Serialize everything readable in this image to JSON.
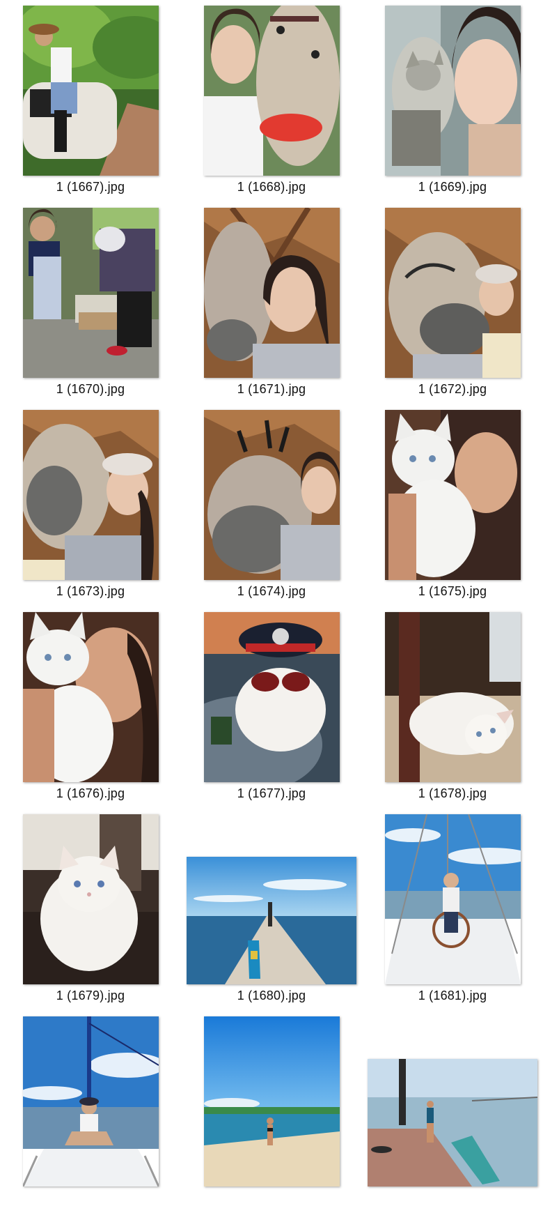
{
  "files": [
    {
      "name": "1 (1667).jpg",
      "thumbnail": "woman-riding-horse-forest"
    },
    {
      "name": "1 (1668).jpg",
      "thumbnail": "selfie-with-horse"
    },
    {
      "name": "1 (1669).jpg",
      "thumbnail": "selfie-with-bengal-cat"
    },
    {
      "name": "1 (1670).jpg",
      "thumbnail": "women-working-outdoors"
    },
    {
      "name": "1 (1671).jpg",
      "thumbnail": "selfie-with-horse-barn"
    },
    {
      "name": "1 (1672).jpg",
      "thumbnail": "selfie-with-horse-cap"
    },
    {
      "name": "1 (1673).jpg",
      "thumbnail": "selfie-with-horse-cap"
    },
    {
      "name": "1 (1674).jpg",
      "thumbnail": "selfie-with-horse-barn"
    },
    {
      "name": "1 (1675).jpg",
      "thumbnail": "selfie-with-white-cat"
    },
    {
      "name": "1 (1676).jpg",
      "thumbnail": "selfie-with-white-cat"
    },
    {
      "name": "1 (1677).jpg",
      "thumbnail": "white-cat-with-hat-sunglasses"
    },
    {
      "name": "1 (1678).jpg",
      "thumbnail": "white-cat-lying-on-rug"
    },
    {
      "name": "1 (1679).jpg",
      "thumbnail": "white-cat-sitting-floor"
    },
    {
      "name": "1 (1680).jpg",
      "thumbnail": "pier-with-paddleboard-sea"
    },
    {
      "name": "1 (1681).jpg",
      "thumbnail": "woman-on-sailboat-helm"
    },
    {
      "name": "",
      "thumbnail": "woman-sitting-on-sailboat-deck"
    },
    {
      "name": "",
      "thumbnail": "woman-on-beach"
    },
    {
      "name": "",
      "thumbnail": "woman-on-dock-with-paddleboard"
    }
  ]
}
